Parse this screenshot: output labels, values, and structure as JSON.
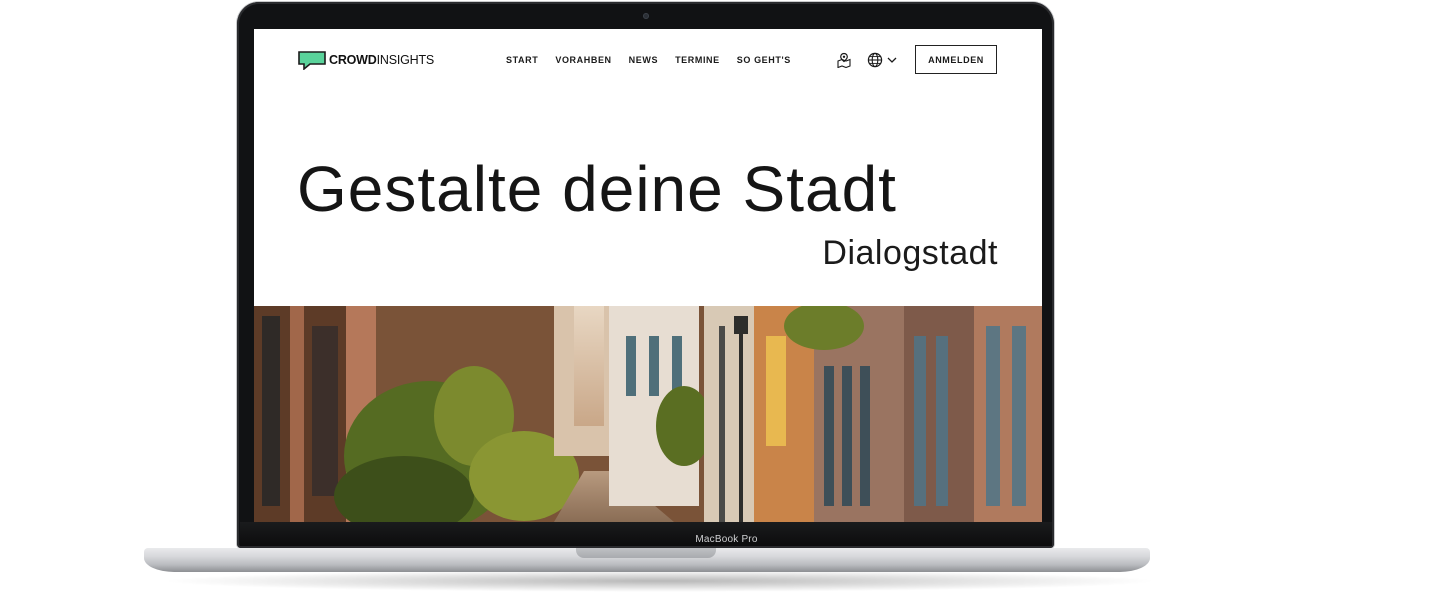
{
  "device": {
    "model_label": "MacBook Pro"
  },
  "site": {
    "logo": {
      "bold": "CROWD",
      "light": "INSIGHTS",
      "color": "#5ad39b"
    },
    "nav": {
      "items": [
        {
          "label": "START"
        },
        {
          "label": "VORAHBEN"
        },
        {
          "label": "NEWS"
        },
        {
          "label": "TERMINE"
        },
        {
          "label": "SO GEHT'S"
        }
      ],
      "login_label": "ANMELDEN",
      "icons": [
        "map-pin-icon",
        "globe-icon",
        "chevron-down-icon"
      ]
    },
    "hero": {
      "headline": "Gestalte deine Stadt",
      "subheadline": "Dialogstadt",
      "image": "street-photo"
    }
  }
}
